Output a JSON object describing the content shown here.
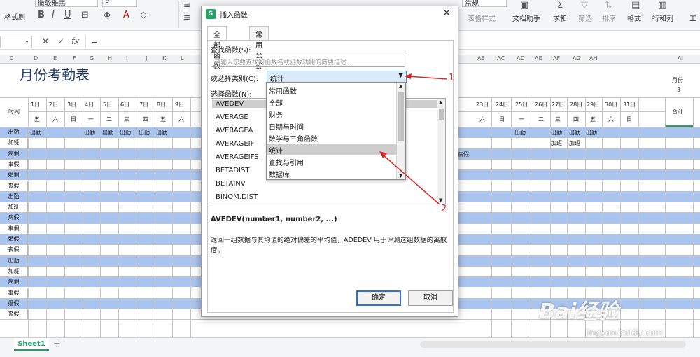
{
  "ribbon": {
    "font_name": "微软雅黑",
    "font_size": "9",
    "format_painter": "格式刷",
    "number_format": "常规",
    "table_style": "表格样式",
    "doc_helper": "文档助手",
    "sum": "求和",
    "filter": "筛选",
    "sort": "排序",
    "format": "格式",
    "row_col": "行和列",
    "sheet": "工"
  },
  "formula_bar": {
    "fx": "fx",
    "value": "="
  },
  "sheet": {
    "title": "月份考勤表",
    "month_label": "月份",
    "month_value": "3",
    "time_label": "时间",
    "total_label": "合计",
    "col_letters": [
      "C",
      "D",
      "E",
      "F",
      "G",
      "H",
      "I",
      "J",
      "K",
      "L",
      "AB",
      "AC",
      "AD",
      "AE",
      "AF",
      "AG",
      "AH",
      "AI"
    ],
    "left_dates": [
      {
        "day": "1日",
        "wk": "五"
      },
      {
        "day": "2日",
        "wk": "六"
      },
      {
        "day": "3日",
        "wk": "日"
      },
      {
        "day": "4日",
        "wk": "一"
      },
      {
        "day": "5日",
        "wk": "二"
      },
      {
        "day": "6日",
        "wk": "三"
      },
      {
        "day": "7日",
        "wk": "四"
      },
      {
        "day": "8日",
        "wk": "五"
      },
      {
        "day": "9日",
        "wk": "六"
      }
    ],
    "right_dates": [
      {
        "day": "23日",
        "wk": "六"
      },
      {
        "day": "24日",
        "wk": "日"
      },
      {
        "day": "25日",
        "wk": "一"
      },
      {
        "day": "26日",
        "wk": "二"
      },
      {
        "day": "27日",
        "wk": "三"
      },
      {
        "day": "28日",
        "wk": "四"
      },
      {
        "day": "29日",
        "wk": "五"
      },
      {
        "day": "30日",
        "wk": "六"
      },
      {
        "day": "31日",
        "wk": "日"
      }
    ],
    "row_labels": [
      "出勤",
      "加班",
      "病假",
      "事假",
      "婚假",
      "丧假",
      "出勤",
      "加班",
      "病假",
      "事假",
      "婚假",
      "丧假",
      "出勤",
      "加班",
      "病假",
      "事假",
      "婚假",
      "丧假"
    ],
    "attend_text": "出勤",
    "overtime_text": "加班",
    "sick_text": "病假",
    "equals": "=",
    "sheet_tab": "Sheet1",
    "add_sheet": "+"
  },
  "dialog": {
    "title": "插入函数",
    "tabs": [
      "全部函数",
      "常用公式"
    ],
    "search_label": "查找函数(S):",
    "search_placeholder": "请输入您要查找的函数名或函数功能的简要描述...",
    "category_label": "或选择类别(C):",
    "category_value": "统计",
    "select_label": "选择函数(N):",
    "functions": [
      "AVEDEV",
      "AVERAGE",
      "AVERAGEA",
      "AVERAGEIF",
      "AVERAGEIFS",
      "BETADIST",
      "BETAINV",
      "BINOM.DIST"
    ],
    "syntax": "AVEDEV(number1, number2, ...)",
    "description": "返回一组数据与其均值的绝对偏差的平均值，ADEDEV 用于评测这组数据的离散度。",
    "ok": "确定",
    "cancel": "取消"
  },
  "dropdown": {
    "items": [
      "常用函数",
      "全部",
      "财务",
      "日期与时间",
      "数学与三角函数",
      "统计",
      "查找与引用",
      "数据库"
    ],
    "highlighted": "统计"
  },
  "annotations": {
    "one": "1",
    "two": "2"
  },
  "watermark": {
    "brand": "Bai经验",
    "url": "jingyan.baidu.com"
  },
  "colors": {
    "accent": "#21a366",
    "row_blue": "#a9c4ef",
    "annotation": "#e02424",
    "select_blue": "#dcebfb"
  }
}
